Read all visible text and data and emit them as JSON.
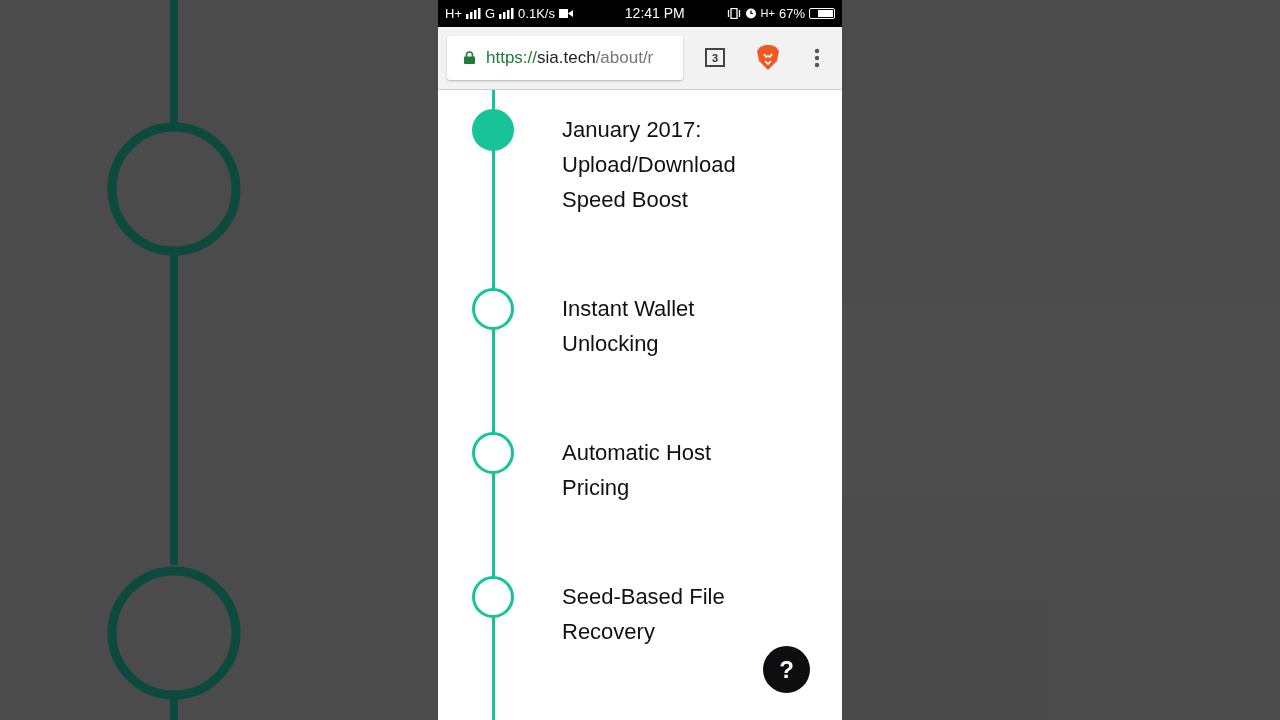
{
  "status_bar": {
    "network_1": "H+",
    "network_2": "G",
    "speed": "0.1K/s",
    "time": "12:41 PM",
    "network_3": "H+",
    "battery": "67%",
    "battery_meter": {
      "level": 0.67
    }
  },
  "address_bar": {
    "scheme": "https://",
    "host": "sia.tech",
    "path": "/about/r",
    "tab_count": "3"
  },
  "timeline": [
    {
      "title": "January 2017: Upload/Download Speed Boost",
      "filled": true
    },
    {
      "title": "Instant Wallet Unlocking",
      "filled": false
    },
    {
      "title": "Automatic Host Pricing",
      "filled": false
    },
    {
      "title": "Seed-Based File Recovery",
      "filled": false
    }
  ],
  "help_button": "?"
}
